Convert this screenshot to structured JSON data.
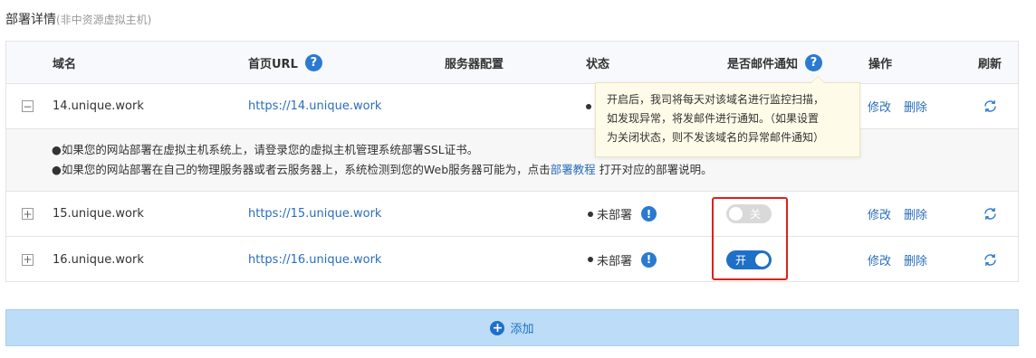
{
  "header": {
    "title": "部署详情",
    "subtitle": "(非中资源虚拟主机)"
  },
  "table": {
    "columns": {
      "domain": "域名",
      "homepage_url": "首页URL",
      "server_config": "服务器配置",
      "status": "状态",
      "email_notify": "是否邮件通知",
      "actions": "操作",
      "refresh": "刷新"
    },
    "help_glyph": "?",
    "rows": [
      {
        "expander": "−",
        "domain": "14.unique.work",
        "url": "https://14.unique.work",
        "status": "",
        "edit": "修改",
        "delete": "删除"
      },
      {
        "expander": "+",
        "domain": "15.unique.work",
        "url": "https://15.unique.work",
        "status": "未部署",
        "warn_glyph": "!",
        "toggle_label": "关",
        "toggle_on": false,
        "edit": "修改",
        "delete": "删除"
      },
      {
        "expander": "+",
        "domain": "16.unique.work",
        "url": "https://16.unique.work",
        "status": "未部署",
        "warn_glyph": "!",
        "toggle_label": "开",
        "toggle_on": true,
        "edit": "修改",
        "delete": "删除"
      }
    ],
    "detail": {
      "line1": "●如果您的网站部署在虚拟主机系统上，请登录您的虚拟主机管理系统部署SSL证书。",
      "line2_prefix": "●如果您的网站部署在自己的物理服务器或者云服务器上，系统检测到您的Web服务器可能为，点击",
      "line2_link": "部署教程",
      "line2_suffix": " 打开对应的部署说明。"
    }
  },
  "tooltip": {
    "line1": "开启后，我司将每天对该域名进行监控扫描，",
    "line2": "如发现异常，将发邮件进行通知。（如果设置",
    "line3": "为关闭状态，则不发该域名的异常邮件通知）"
  },
  "add_button": {
    "plus_glyph": "+",
    "label": "添加"
  },
  "icons": {
    "help": "help-circle-icon",
    "warning": "exclamation-circle-icon",
    "refresh": "refresh-icon",
    "add": "plus-circle-icon",
    "expand": "expand-square-icon",
    "collapse": "collapse-square-icon"
  },
  "colors": {
    "accent": "#1e70c7",
    "link": "#2a6ebb",
    "highlight_border": "#e0201a",
    "toggle_off": "#d9d9d9",
    "add_bar_bg": "#bcdcf7",
    "tooltip_bg": "#fffbe9"
  }
}
